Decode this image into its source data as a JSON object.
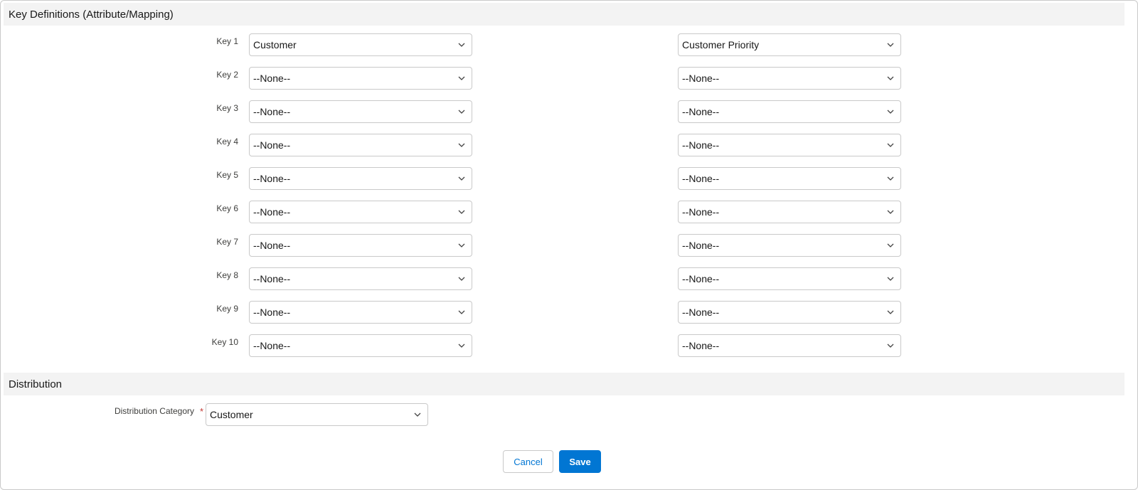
{
  "sections": {
    "key_definitions": "Key Definitions (Attribute/Mapping)",
    "distribution": "Distribution"
  },
  "keys": [
    {
      "label": "Key 1",
      "attribute": "Customer",
      "mapping": "Customer Priority"
    },
    {
      "label": "Key 2",
      "attribute": "--None--",
      "mapping": "--None--"
    },
    {
      "label": "Key 3",
      "attribute": "--None--",
      "mapping": "--None--"
    },
    {
      "label": "Key 4",
      "attribute": "--None--",
      "mapping": "--None--"
    },
    {
      "label": "Key 5",
      "attribute": "--None--",
      "mapping": "--None--"
    },
    {
      "label": "Key 6",
      "attribute": "--None--",
      "mapping": "--None--"
    },
    {
      "label": "Key 7",
      "attribute": "--None--",
      "mapping": "--None--"
    },
    {
      "label": "Key 8",
      "attribute": "--None--",
      "mapping": "--None--"
    },
    {
      "label": "Key 9",
      "attribute": "--None--",
      "mapping": "--None--"
    },
    {
      "label": "Key 10",
      "attribute": "--None--",
      "mapping": "--None--"
    }
  ],
  "distribution": {
    "category_label": "Distribution Category",
    "required_marker": "*",
    "category_value": "Customer"
  },
  "footer": {
    "cancel_label": "Cancel",
    "save_label": "Save"
  },
  "colors": {
    "brand": "#0176d3",
    "required": "#c23934",
    "section_bg": "#f3f3f3"
  },
  "icons": {
    "select_chevron": "chevron-down-icon"
  }
}
